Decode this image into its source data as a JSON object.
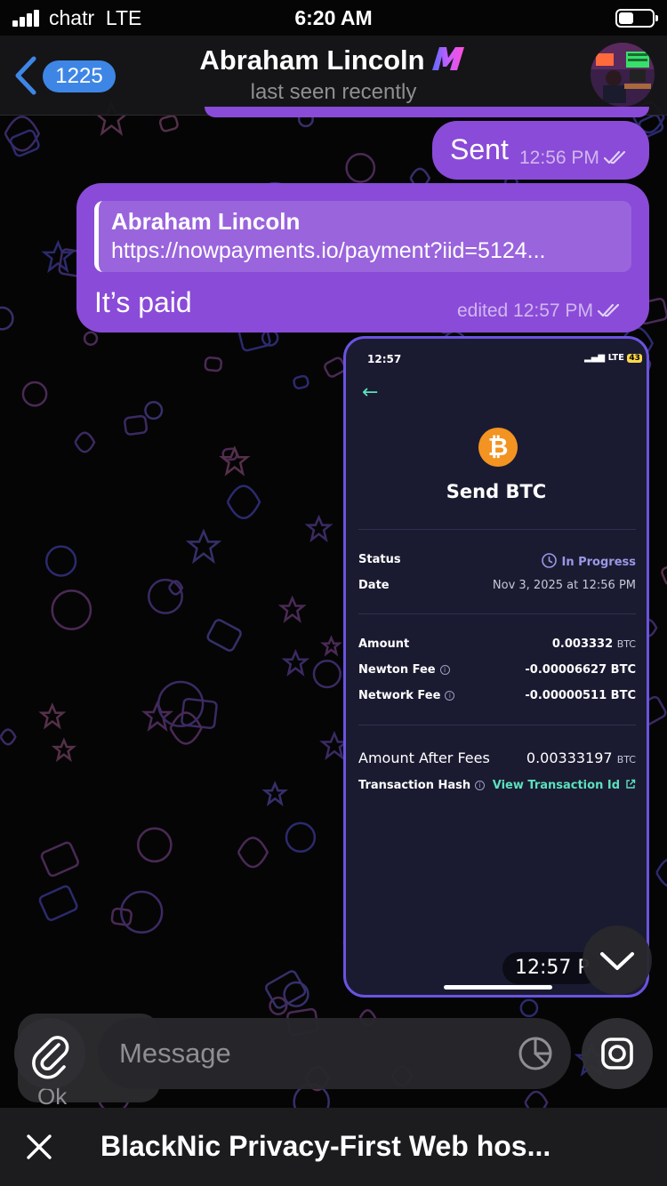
{
  "status_bar": {
    "carrier": "chatr",
    "network": "LTE",
    "time": "6:20 AM"
  },
  "header": {
    "back_count": "1225",
    "title": "Abraham Lincoln",
    "subtitle": "last seen recently",
    "title_emoji": "purple-m-emoji"
  },
  "messages": {
    "sent": {
      "text": "Sent",
      "time": "12:56 PM"
    },
    "reply": {
      "quote_name": "Abraham Lincoln",
      "quote_link": "https://nowpayments.io/payment?iid=5124...",
      "text": "It’s paid",
      "meta": "edited 12:57 PM"
    },
    "screenshot": {
      "time": "12:57 P",
      "phone": {
        "time": "12:57",
        "network": "LTE",
        "battery": "43",
        "coin_symbol": "₿",
        "title": "Send BTC",
        "status_label": "Status",
        "status_value": "In Progress",
        "date_label": "Date",
        "date_value": "Nov 3, 2025 at 12:56 PM",
        "amount_label": "Amount",
        "amount_value": "0.003332",
        "unit": "BTC",
        "newton_fee_label": "Newton Fee",
        "newton_fee_value": "-0.00006627 BTC",
        "network_fee_label": "Network Fee",
        "network_fee_value": "-0.00000511 BTC",
        "after_fees_label": "Amount After Fees",
        "after_fees_value": "0.00333197",
        "hash_label": "Transaction Hash",
        "hash_link": "View Transaction Id"
      }
    }
  },
  "input": {
    "placeholder": "Message",
    "behind_text": "Ok"
  },
  "banner": {
    "text": "BlackNic Privacy-First Web hos..."
  },
  "colors": {
    "bubble": "#8a4bd8",
    "badge": "#3e86e6",
    "accent_green": "#5ce0bd",
    "bitcoin": "#f39321"
  }
}
